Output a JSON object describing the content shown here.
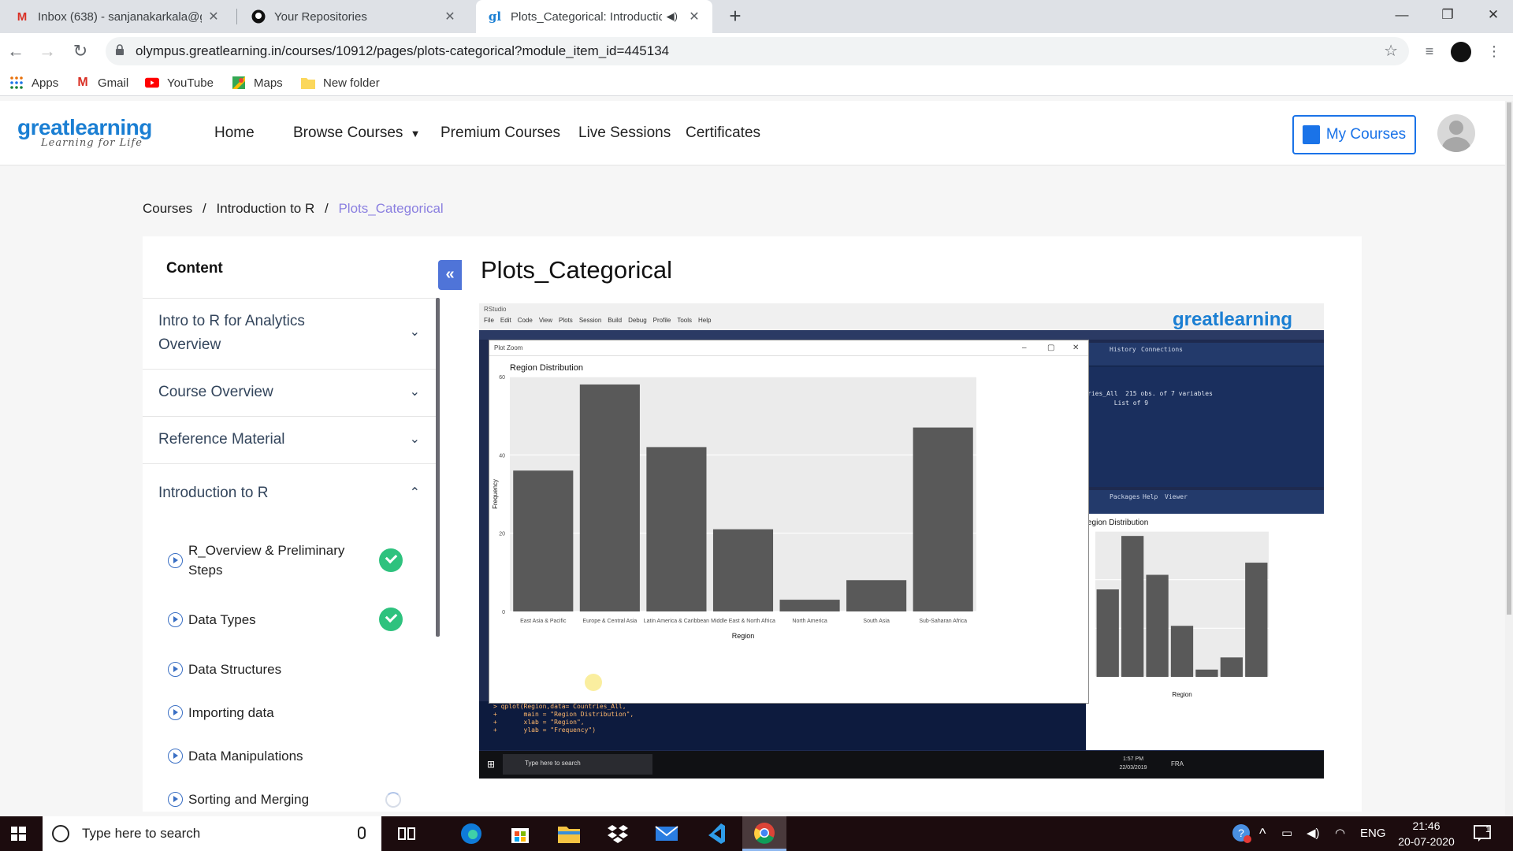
{
  "browser": {
    "tabs": [
      {
        "title": "Inbox (638) - sanjanakarkala@gmail.com",
        "icon": "gmail-icon"
      },
      {
        "title": "Your Repositories",
        "icon": "github-icon"
      },
      {
        "title": "Plots_Categorical: Introduction to R",
        "icon": "greatlearning-icon"
      }
    ],
    "url": "olympus.greatlearning.in/courses/10912/pages/plots-categorical?module_item_id=445134",
    "bookmarks": [
      "Apps",
      "Gmail",
      "YouTube",
      "Maps",
      "New folder"
    ]
  },
  "site": {
    "logo_main": "greatlearning",
    "logo_tagline": "Learning for Life",
    "nav": [
      "Home",
      "Browse Courses",
      "Premium Courses",
      "Live Sessions",
      "Certificates"
    ],
    "my_courses": "My Courses"
  },
  "breadcrumb": [
    "Courses",
    "Introduction to R",
    "Plots_Categorical"
  ],
  "sidebar": {
    "title": "Content",
    "sections": [
      {
        "label": "Intro to R for Analytics Overview",
        "expanded": false
      },
      {
        "label": "Course Overview",
        "expanded": false
      },
      {
        "label": "Reference Material",
        "expanded": false
      },
      {
        "label": "Introduction to R",
        "expanded": true
      }
    ],
    "lessons": [
      {
        "label": "R_Overview & Preliminary Steps",
        "status": "complete"
      },
      {
        "label": "Data Types",
        "status": "complete"
      },
      {
        "label": "Data Structures",
        "status": "none"
      },
      {
        "label": "Importing data",
        "status": "none"
      },
      {
        "label": "Data Manipulations",
        "status": "none"
      },
      {
        "label": "Sorting and Merging",
        "status": "in-progress"
      }
    ]
  },
  "page_title": "Plots_Categorical",
  "embedded_screenshot": {
    "rstudio_title": "RStudio",
    "menu": [
      "File",
      "Edit",
      "Code",
      "View",
      "Plots",
      "Session",
      "Build",
      "Debug",
      "Profile",
      "Tools",
      "Help"
    ],
    "watermark": "greatlearning",
    "plot_zoom_title": "Plot Zoom",
    "env_lines": [
      "ries_All  215 obs. of 7 variables",
      "       List of 9"
    ],
    "pane_tabs_top": [
      "History",
      "Connections"
    ],
    "pane_tabs_bottom": [
      "Packages",
      "Help",
      "Viewer"
    ],
    "console_lines": [
      "> qplot(Region,data= Countries_All,",
      "+       main = \"Region Distribution\",",
      "+       xlab = \"Region\",",
      "+       ylab = \"Frequency\")"
    ],
    "taskbar_search": "Type here to search",
    "taskbar_time": "1:57 PM",
    "taskbar_date": "22/03/2019",
    "taskbar_lang": "FRA",
    "mini_title": "egion Distribution",
    "mini_xlabel": "Region"
  },
  "chart_data": {
    "type": "bar",
    "title": "Region Distribution",
    "xlabel": "Region",
    "ylabel": "Frequency",
    "categories": [
      "East Asia & Pacific",
      "Europe & Central Asia",
      "Latin America & Caribbean",
      "Middle East & North Africa",
      "North America",
      "South Asia",
      "Sub-Saharan Africa"
    ],
    "values": [
      36,
      58,
      42,
      21,
      3,
      8,
      47
    ],
    "ylim": [
      0,
      60
    ],
    "yticks": [
      0,
      20,
      40,
      60
    ],
    "grid": true,
    "bar_color": "#595959",
    "panel_color": "#ebebeb"
  },
  "windows": {
    "search_placeholder": "Type here to search",
    "lang": "ENG",
    "time": "21:46",
    "date": "20-07-2020",
    "notifications": "1"
  }
}
